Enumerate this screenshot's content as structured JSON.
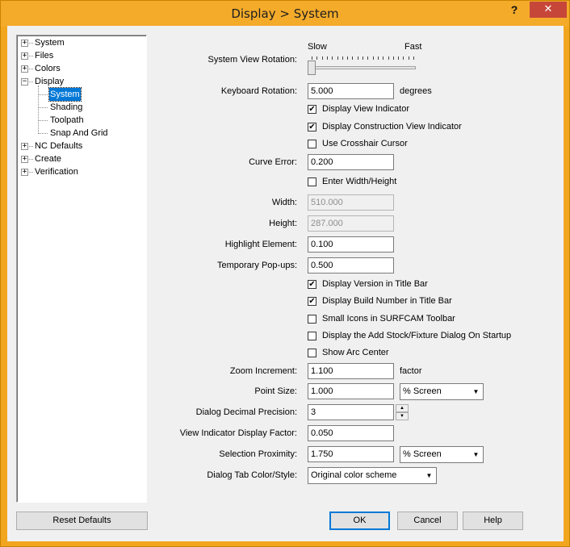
{
  "window": {
    "title": "Display > System",
    "help_label": "?",
    "close_label": "✕"
  },
  "tree": [
    {
      "label": "System",
      "expander": "+",
      "level": 0,
      "selected": false
    },
    {
      "label": "Files",
      "expander": "+",
      "level": 0,
      "selected": false
    },
    {
      "label": "Colors",
      "expander": "+",
      "level": 0,
      "selected": false
    },
    {
      "label": "Display",
      "expander": "−",
      "level": 0,
      "selected": false
    },
    {
      "label": "System",
      "expander": "",
      "level": 1,
      "selected": true
    },
    {
      "label": "Shading",
      "expander": "",
      "level": 1,
      "selected": false
    },
    {
      "label": "Toolpath",
      "expander": "",
      "level": 1,
      "selected": false
    },
    {
      "label": "Snap And Grid",
      "expander": "",
      "level": 1,
      "selected": false
    },
    {
      "label": "NC Defaults",
      "expander": "+",
      "level": 0,
      "selected": false
    },
    {
      "label": "Create",
      "expander": "+",
      "level": 0,
      "selected": false
    },
    {
      "label": "Verification",
      "expander": "+",
      "level": 0,
      "selected": false
    }
  ],
  "slider": {
    "label": "System View Rotation:",
    "min_label": "Slow",
    "max_label": "Fast",
    "value_fraction": 0.0
  },
  "keyboard_rotation": {
    "label": "Keyboard Rotation:",
    "value": "5.000",
    "unit": "degrees"
  },
  "checkboxes_top": [
    {
      "label": "Display View Indicator",
      "checked": true
    },
    {
      "label": "Display Construction View Indicator",
      "checked": true
    },
    {
      "label": "Use Crosshair Cursor",
      "checked": false
    }
  ],
  "curve_error": {
    "label": "Curve Error:",
    "value": "0.200"
  },
  "enter_width_height": {
    "label": "Enter Width/Height",
    "checked": false
  },
  "width": {
    "label": "Width:",
    "value": "510.000"
  },
  "height": {
    "label": "Height:",
    "value": "287.000"
  },
  "highlight_element": {
    "label": "Highlight Element:",
    "value": "0.100"
  },
  "temporary_popups": {
    "label": "Temporary Pop-ups:",
    "value": "0.500"
  },
  "checkboxes_mid": [
    {
      "label": "Display Version in Title Bar",
      "checked": true
    },
    {
      "label": "Display Build Number in Title Bar",
      "checked": true
    },
    {
      "label": "Small Icons in SURFCAM Toolbar",
      "checked": false
    },
    {
      "label": "Display the Add Stock/Fixture Dialog On Startup",
      "checked": false
    },
    {
      "label": "Show Arc Center",
      "checked": false
    }
  ],
  "zoom_increment": {
    "label": "Zoom Increment:",
    "value": "1.100",
    "unit": "factor"
  },
  "point_size": {
    "label": "Point Size:",
    "value": "1.000",
    "mode": "% Screen"
  },
  "dialog_decimal_precision": {
    "label": "Dialog Decimal Precision:",
    "value": "3"
  },
  "view_indicator_display_factor": {
    "label": "View Indicator Display Factor:",
    "value": "0.050"
  },
  "selection_proximity": {
    "label": "Selection Proximity:",
    "value": "1.750",
    "mode": "% Screen"
  },
  "dialog_tab_color": {
    "label": "Dialog Tab Color/Style:",
    "value": "Original color scheme"
  },
  "buttons": {
    "reset": "Reset Defaults",
    "ok": "OK",
    "cancel": "Cancel",
    "help": "Help"
  },
  "glyphs": {
    "check": "✔",
    "dropdown_arrow": "▼",
    "spin_up": "▲",
    "spin_down": "▼"
  }
}
